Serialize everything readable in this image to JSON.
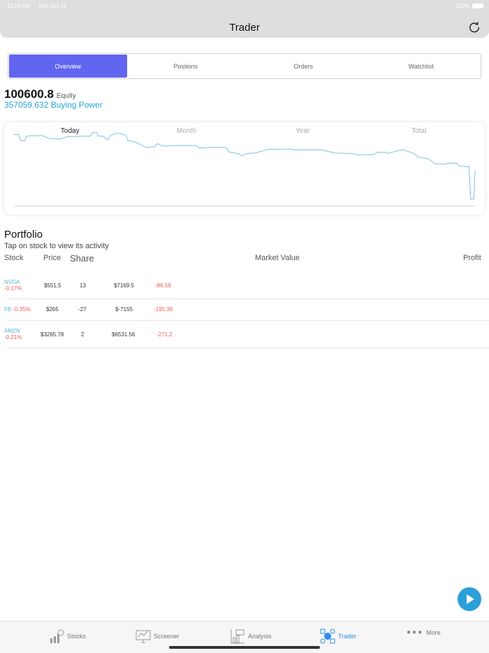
{
  "status": {
    "time": "11:50 AM",
    "date": "Sun Oct 18",
    "battery": "100%"
  },
  "header": {
    "title": "Trader"
  },
  "segments": [
    "Overview",
    "Postions",
    "Orders",
    "Watchlist"
  ],
  "account": {
    "equity": "100600.8",
    "equity_label": "Equity",
    "buying_power": "357059.632 Buying Power"
  },
  "chart_tabs": [
    "Today",
    "Month",
    "Year",
    "Total"
  ],
  "chart_data": {
    "type": "line",
    "title": "",
    "xlabel": "",
    "ylabel": "",
    "grid": false,
    "x": [
      0,
      15,
      22,
      35,
      40,
      90,
      115,
      150,
      170,
      245,
      252,
      265,
      270,
      285,
      300,
      310,
      325,
      340,
      360,
      365,
      390,
      415,
      425,
      450,
      460,
      475,
      545,
      585,
      595,
      630,
      680,
      690,
      720,
      730,
      745,
      775,
      815,
      890,
      900,
      985,
      1030,
      1085,
      1105,
      1155,
      1165,
      1195,
      1200,
      1225,
      1245,
      1255,
      1285,
      1295,
      1325,
      1335,
      1350,
      1385,
      1390,
      1420,
      1430,
      1460,
      1465,
      1475,
      1479
    ],
    "y": [
      238,
      238,
      218,
      218,
      233,
      235,
      225,
      223,
      231,
      233,
      244,
      244,
      233,
      233,
      220,
      235,
      242,
      242,
      235,
      218,
      213,
      200,
      195,
      197,
      208,
      200,
      202,
      201,
      193,
      196,
      195,
      180,
      175,
      167,
      175,
      177,
      189,
      190,
      187,
      187,
      177,
      175,
      170,
      172,
      179,
      179,
      175,
      183,
      187,
      185,
      175,
      163,
      159,
      153,
      141,
      140,
      143,
      143,
      133,
      131,
      23,
      23,
      118
    ],
    "ylim": [
      0,
      260
    ]
  },
  "portfolio": {
    "title": "Portfolio",
    "subtitle": "Tap on stock to view its activity",
    "columns": [
      "Stock",
      "Price",
      "Share",
      "Market Value",
      "Profit"
    ],
    "rows": [
      {
        "symbol": "NVDA",
        "change": "-0.17%",
        "price": "$551.5",
        "shares": "13",
        "value": "$7169.5",
        "profit": "-86.58"
      },
      {
        "symbol": "FB",
        "change": "-0.35%",
        "price": "$265",
        "shares": "-27",
        "value": "$-7155",
        "profit": "-195.38"
      },
      {
        "symbol": "AMZN",
        "change": "-0.21%",
        "price": "$3265.78",
        "shares": "2",
        "value": "$6531.56",
        "profit": "-271.2"
      }
    ]
  },
  "tabbar": [
    "Stocks",
    "Screener",
    "Analysis",
    "Trader",
    "More"
  ],
  "colors": {
    "accent": "#6165f0",
    "link": "#2aa4d8",
    "negative": "#f05a5a",
    "line": "#8fcbe6",
    "active_tab": "#2f8cf0"
  }
}
